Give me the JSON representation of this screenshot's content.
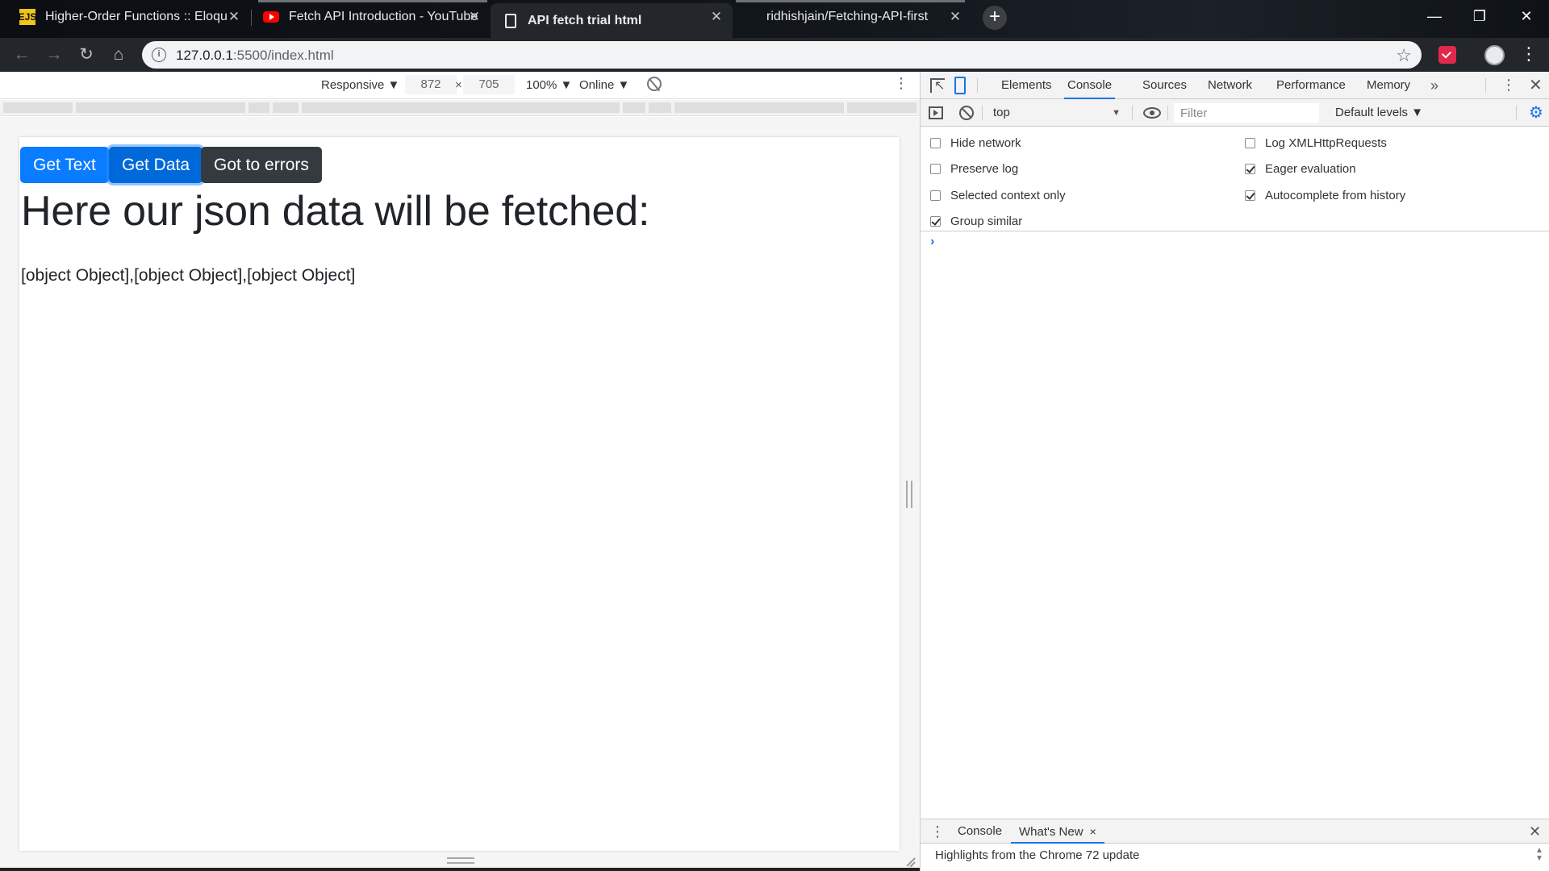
{
  "browser": {
    "tabs": [
      {
        "title": "Higher-Order Functions :: Eloque",
        "favicon": "ejs-icon",
        "favicon_text": "EJS",
        "active": false
      },
      {
        "title": "Fetch API Introduction - YouTube",
        "favicon": "youtube-icon",
        "active": false
      },
      {
        "title": "API fetch trial html",
        "favicon": "document-icon",
        "active": true
      },
      {
        "title": "ridhishjain/Fetching-API-first-App",
        "favicon": "github-icon",
        "active": false
      }
    ],
    "url_host": "127.0.0.1",
    "url_rest": ":5500/index.html"
  },
  "device_toolbar": {
    "mode": "Responsive ▼",
    "width": "872",
    "times": "×",
    "height": "705",
    "zoom": "100% ▼",
    "network": "Online ▼"
  },
  "page": {
    "buttons": {
      "get_text": "Get Text",
      "get_data": "Get Data",
      "errors": "Got to errors"
    },
    "heading": "Here our json data will be fetched:",
    "output": "[object Object],[object Object],[object Object]"
  },
  "devtools": {
    "tabs": [
      "Elements",
      "Console",
      "Sources",
      "Network",
      "Performance",
      "Memory"
    ],
    "active_tab": "Console",
    "more": "»",
    "context": "top",
    "filter_placeholder": "Filter",
    "levels": "Default levels ▼",
    "settings_left": [
      {
        "label": "Hide network",
        "checked": false
      },
      {
        "label": "Preserve log",
        "checked": false
      },
      {
        "label": "Selected context only",
        "checked": false
      },
      {
        "label": "Group similar",
        "checked": true
      }
    ],
    "settings_right": [
      {
        "label": "Log XMLHttpRequests",
        "checked": false
      },
      {
        "label": "Eager evaluation",
        "checked": true
      },
      {
        "label": "Autocomplete from history",
        "checked": true
      }
    ],
    "prompt": "›",
    "drawer": {
      "tabs": [
        "Console",
        "What's New"
      ],
      "active_tab": "What's New",
      "close_glyph": "×",
      "body": "Highlights from the Chrome 72 update"
    }
  },
  "colors": {
    "primary_button": "#0a7cff",
    "dark_button": "#343a40",
    "accent": "#1a73e8"
  }
}
